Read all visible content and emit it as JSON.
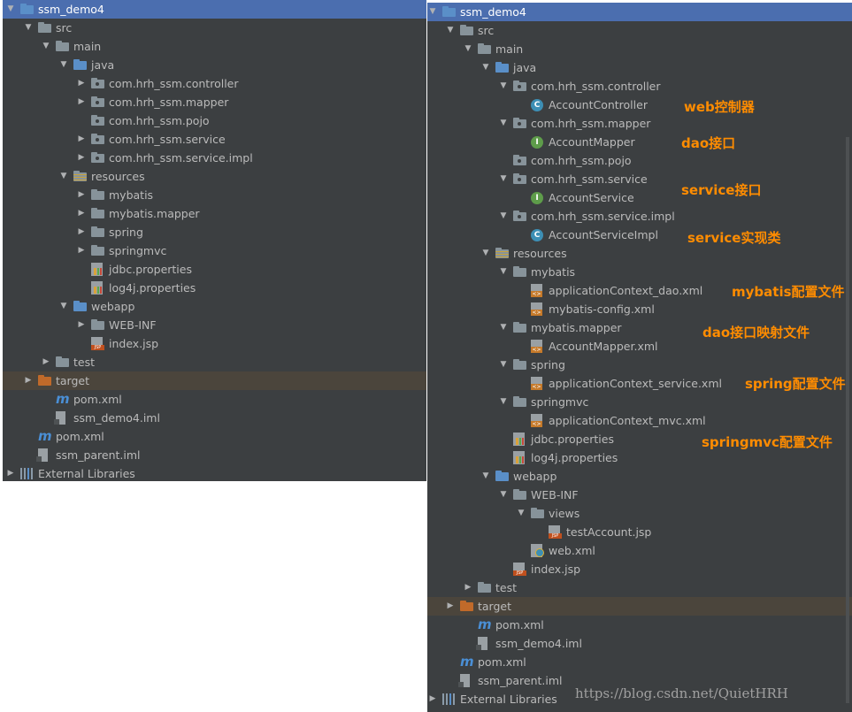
{
  "left_tree": [
    {
      "label": "ssm_demo4",
      "icon": "module-folder",
      "level": 0,
      "arrow": "down",
      "state": "selected"
    },
    {
      "label": "src",
      "icon": "folder",
      "level": 1,
      "arrow": "down"
    },
    {
      "label": "main",
      "icon": "folder",
      "level": 2,
      "arrow": "down"
    },
    {
      "label": "java",
      "icon": "source-folder",
      "level": 3,
      "arrow": "down"
    },
    {
      "label": "com.hrh_ssm.controller",
      "icon": "package",
      "level": 4,
      "arrow": "right"
    },
    {
      "label": "com.hrh_ssm.mapper",
      "icon": "package",
      "level": 4,
      "arrow": "right"
    },
    {
      "label": "com.hrh_ssm.pojo",
      "icon": "package",
      "level": 4,
      "arrow": ""
    },
    {
      "label": "com.hrh_ssm.service",
      "icon": "package",
      "level": 4,
      "arrow": "right"
    },
    {
      "label": "com.hrh_ssm.service.impl",
      "icon": "package",
      "level": 4,
      "arrow": "right"
    },
    {
      "label": "resources",
      "icon": "resources-folder",
      "level": 3,
      "arrow": "down"
    },
    {
      "label": "mybatis",
      "icon": "folder",
      "level": 4,
      "arrow": "right"
    },
    {
      "label": "mybatis.mapper",
      "icon": "folder",
      "level": 4,
      "arrow": "right"
    },
    {
      "label": "spring",
      "icon": "folder",
      "level": 4,
      "arrow": "right"
    },
    {
      "label": "springmvc",
      "icon": "folder",
      "level": 4,
      "arrow": "right"
    },
    {
      "label": "jdbc.properties",
      "icon": "properties-file",
      "level": 4,
      "arrow": ""
    },
    {
      "label": "log4j.properties",
      "icon": "properties-file",
      "level": 4,
      "arrow": ""
    },
    {
      "label": "webapp",
      "icon": "web-folder",
      "level": 3,
      "arrow": "down"
    },
    {
      "label": "WEB-INF",
      "icon": "folder",
      "level": 4,
      "arrow": "right"
    },
    {
      "label": "index.jsp",
      "icon": "jsp-file",
      "level": 4,
      "arrow": ""
    },
    {
      "label": "test",
      "icon": "folder",
      "level": 2,
      "arrow": "right"
    },
    {
      "label": "target",
      "icon": "excluded-folder",
      "level": 1,
      "arrow": "right",
      "state": "highlight"
    },
    {
      "label": "pom.xml",
      "icon": "maven-file",
      "level": 2,
      "arrow": ""
    },
    {
      "label": "ssm_demo4.iml",
      "icon": "iml-file",
      "level": 2,
      "arrow": ""
    },
    {
      "label": "pom.xml",
      "icon": "maven-file",
      "level": 1,
      "arrow": ""
    },
    {
      "label": "ssm_parent.iml",
      "icon": "iml-file",
      "level": 1,
      "arrow": ""
    },
    {
      "label": "External Libraries",
      "icon": "libraries",
      "level": 0,
      "arrow": "right"
    }
  ],
  "right_tree": [
    {
      "label": "ssm_demo4",
      "icon": "module-folder",
      "level": 0,
      "arrow": "down",
      "state": "selected"
    },
    {
      "label": "src",
      "icon": "folder",
      "level": 1,
      "arrow": "down"
    },
    {
      "label": "main",
      "icon": "folder",
      "level": 2,
      "arrow": "down"
    },
    {
      "label": "java",
      "icon": "source-folder",
      "level": 3,
      "arrow": "down"
    },
    {
      "label": "com.hrh_ssm.controller",
      "icon": "package",
      "level": 4,
      "arrow": "down"
    },
    {
      "label": "AccountController",
      "icon": "class",
      "level": 5,
      "arrow": ""
    },
    {
      "label": "com.hrh_ssm.mapper",
      "icon": "package",
      "level": 4,
      "arrow": "down"
    },
    {
      "label": "AccountMapper",
      "icon": "interface",
      "level": 5,
      "arrow": ""
    },
    {
      "label": "com.hrh_ssm.pojo",
      "icon": "package",
      "level": 4,
      "arrow": ""
    },
    {
      "label": "com.hrh_ssm.service",
      "icon": "package",
      "level": 4,
      "arrow": "down"
    },
    {
      "label": "AccountService",
      "icon": "interface",
      "level": 5,
      "arrow": ""
    },
    {
      "label": "com.hrh_ssm.service.impl",
      "icon": "package",
      "level": 4,
      "arrow": "down"
    },
    {
      "label": "AccountServiceImpl",
      "icon": "class",
      "level": 5,
      "arrow": ""
    },
    {
      "label": "resources",
      "icon": "resources-folder",
      "level": 3,
      "arrow": "down"
    },
    {
      "label": "mybatis",
      "icon": "folder",
      "level": 4,
      "arrow": "down"
    },
    {
      "label": "applicationContext_dao.xml",
      "icon": "xml-file",
      "level": 5,
      "arrow": ""
    },
    {
      "label": "mybatis-config.xml",
      "icon": "xml-file",
      "level": 5,
      "arrow": ""
    },
    {
      "label": "mybatis.mapper",
      "icon": "folder",
      "level": 4,
      "arrow": "down"
    },
    {
      "label": "AccountMapper.xml",
      "icon": "xml-file",
      "level": 5,
      "arrow": ""
    },
    {
      "label": "spring",
      "icon": "folder",
      "level": 4,
      "arrow": "down"
    },
    {
      "label": "applicationContext_service.xml",
      "icon": "xml-file",
      "level": 5,
      "arrow": ""
    },
    {
      "label": "springmvc",
      "icon": "folder",
      "level": 4,
      "arrow": "down"
    },
    {
      "label": "applicationContext_mvc.xml",
      "icon": "xml-file",
      "level": 5,
      "arrow": ""
    },
    {
      "label": "jdbc.properties",
      "icon": "properties-file",
      "level": 4,
      "arrow": ""
    },
    {
      "label": "log4j.properties",
      "icon": "properties-file",
      "level": 4,
      "arrow": ""
    },
    {
      "label": "webapp",
      "icon": "web-folder",
      "level": 3,
      "arrow": "down"
    },
    {
      "label": "WEB-INF",
      "icon": "folder",
      "level": 4,
      "arrow": "down"
    },
    {
      "label": "views",
      "icon": "folder",
      "level": 5,
      "arrow": "down"
    },
    {
      "label": "testAccount.jsp",
      "icon": "jsp-file",
      "level": 6,
      "arrow": ""
    },
    {
      "label": "web.xml",
      "icon": "web-xml-file",
      "level": 5,
      "arrow": ""
    },
    {
      "label": "index.jsp",
      "icon": "jsp-file",
      "level": 4,
      "arrow": ""
    },
    {
      "label": "test",
      "icon": "folder",
      "level": 2,
      "arrow": "right"
    },
    {
      "label": "target",
      "icon": "excluded-folder",
      "level": 1,
      "arrow": "right",
      "state": "highlight"
    },
    {
      "label": "pom.xml",
      "icon": "maven-file",
      "level": 2,
      "arrow": ""
    },
    {
      "label": "ssm_demo4.iml",
      "icon": "iml-file",
      "level": 2,
      "arrow": ""
    },
    {
      "label": "pom.xml",
      "icon": "maven-file",
      "level": 1,
      "arrow": ""
    },
    {
      "label": "ssm_parent.iml",
      "icon": "iml-file",
      "level": 1,
      "arrow": ""
    },
    {
      "label": "External Libraries",
      "icon": "libraries",
      "level": 0,
      "arrow": "right"
    }
  ],
  "annotations": {
    "web_controller": "web控制器",
    "dao_interface": "dao接口",
    "service_interface": "service接口",
    "service_impl": "service实现类",
    "mybatis_config": "mybatis配置文件",
    "dao_mapping": "dao接口映射文件",
    "spring_config": "spring配置文件",
    "springmvc_config": "springmvc配置文件"
  },
  "watermark": "https://blog.csdn.net/QuietHRH",
  "colors": {
    "panel_bg": "#3c3f41",
    "selected_row": "#4b6eaf",
    "highlight_row": "#4b453c",
    "annotation": "#ff8c00"
  }
}
